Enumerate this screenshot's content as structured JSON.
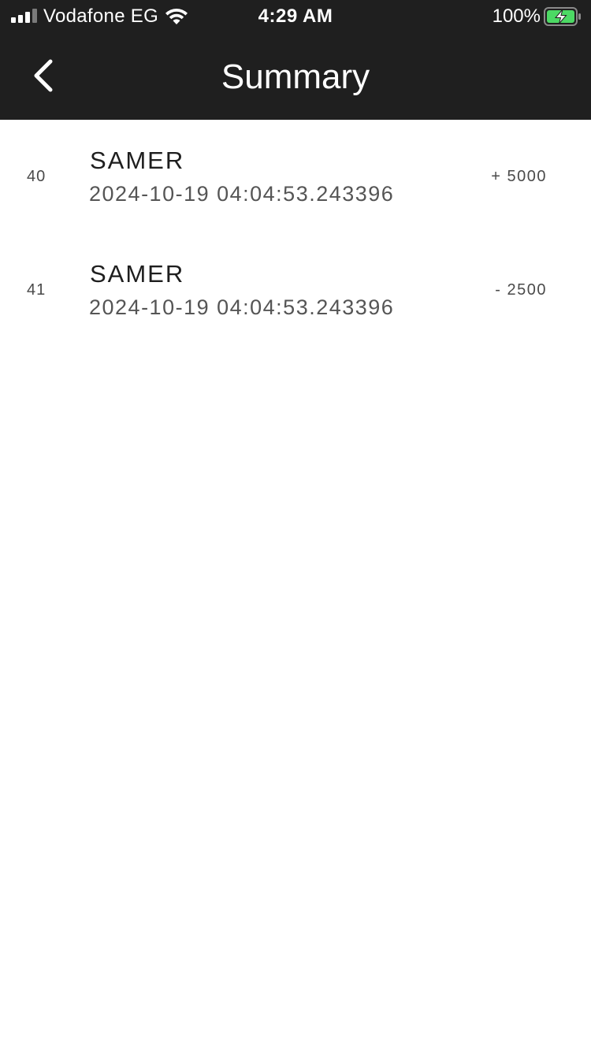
{
  "status_bar": {
    "carrier": "Vodafone EG",
    "time": "4:29 AM",
    "battery_percent": "100%",
    "battery_color": "#4cd964"
  },
  "nav": {
    "back_icon": "chevron-left-icon",
    "title": "Summary"
  },
  "transactions": [
    {
      "id": "40",
      "name": "SAMER",
      "date": "2024-10-19 04:04:53.243396",
      "amount": "+ 5000"
    },
    {
      "id": "41",
      "name": "SAMER",
      "date": "2024-10-19 04:04:53.243396",
      "amount": "- 2500"
    }
  ]
}
